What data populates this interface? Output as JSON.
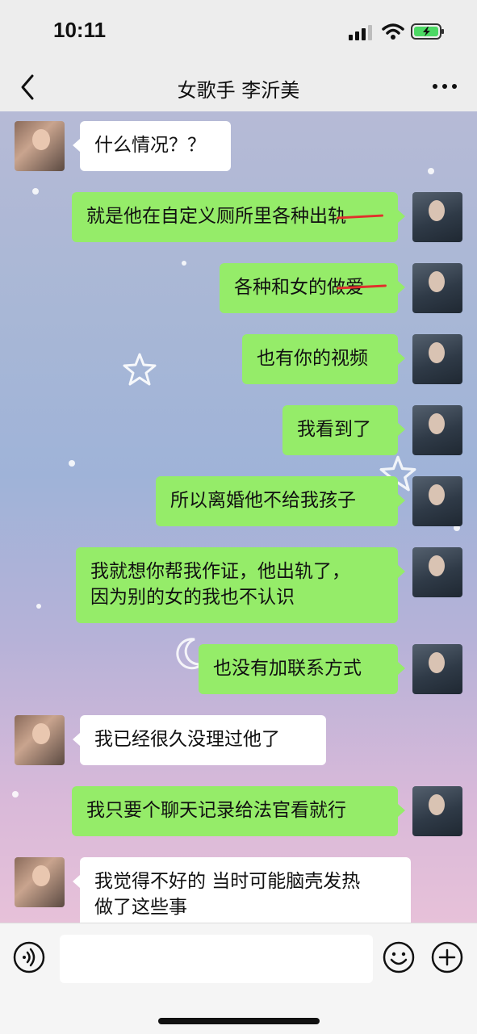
{
  "status_bar": {
    "time": "10:11"
  },
  "header": {
    "title": "女歌手 李沂美"
  },
  "messages": [
    {
      "from": "peer",
      "text": "什么情况？？"
    },
    {
      "from": "me",
      "text": "就是他在自定义厕所里各种出轨"
    },
    {
      "from": "me",
      "text": "各种和女的做爱"
    },
    {
      "from": "me",
      "text": "也有你的视频"
    },
    {
      "from": "me",
      "text": "我看到了"
    },
    {
      "from": "me",
      "text": "所以离婚他不给我孩子"
    },
    {
      "from": "me",
      "lines": [
        "我就想你帮我作证，他出轨了，",
        "因为别的女的我也不认识"
      ]
    },
    {
      "from": "me",
      "text": "也没有加联系方式"
    },
    {
      "from": "peer",
      "text": "我已经很久没理过他了"
    },
    {
      "from": "me",
      "text": "我只要个聊天记录给法官看就行"
    },
    {
      "from": "peer",
      "lines": [
        "我觉得不好的 当时可能脑壳发热",
        "做了这些事"
      ]
    }
  ],
  "input_bar": {
    "placeholder": ""
  },
  "colors": {
    "outgoing_bubble": "#95ec69",
    "incoming_bubble": "#ffffff",
    "strikethrough": "#e0312c",
    "chrome": "#ededed"
  },
  "icons": [
    "back-icon",
    "more-icon",
    "voice-icon",
    "emoji-icon",
    "plus-icon",
    "signal-icon",
    "wifi-icon",
    "battery-icon"
  ]
}
